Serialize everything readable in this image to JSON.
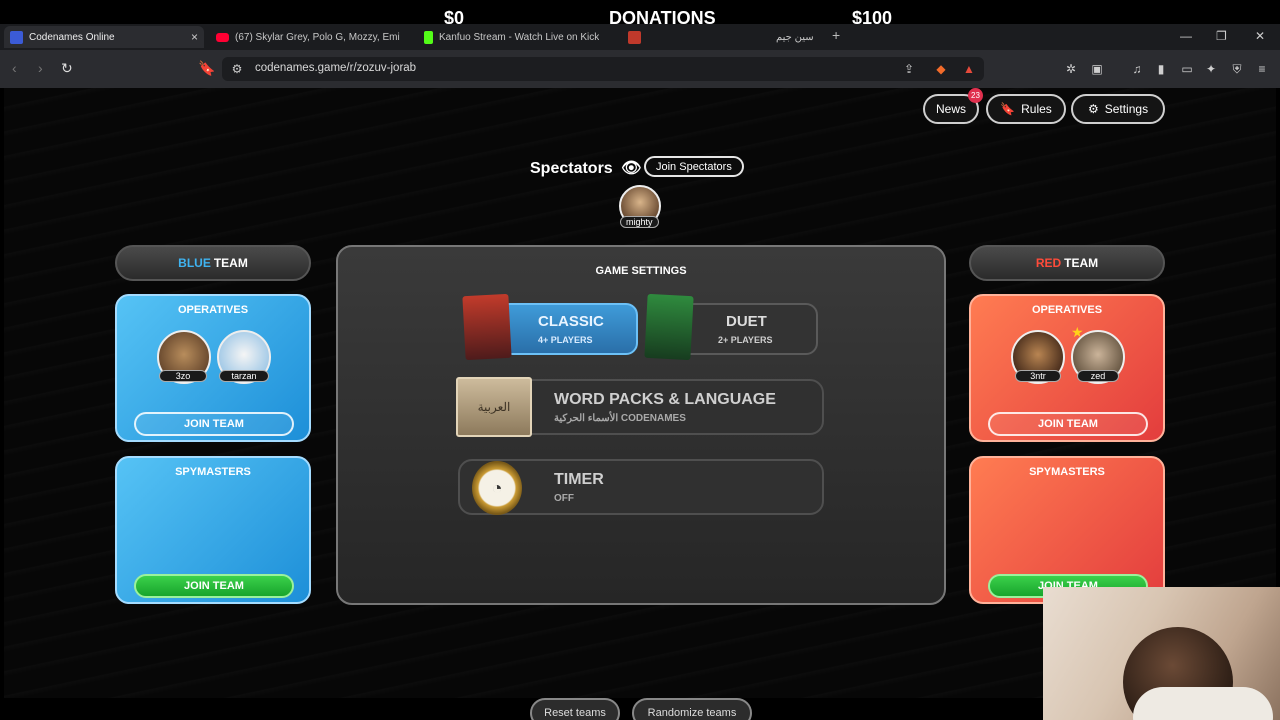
{
  "overlay": {
    "donation_current": "$0",
    "donation_title": "DONATIONS",
    "donation_goal": "$100"
  },
  "browser": {
    "tabs": [
      {
        "title": "Codenames Online",
        "close": "×",
        "active": true,
        "color": "#3b5bd6"
      },
      {
        "title": "(67) Skylar Grey, Polo G, Mozzy, Emi",
        "color": "#ff0033"
      },
      {
        "title": "Kanfuo Stream - Watch Live on Kick",
        "color": "#53fc18"
      },
      {
        "title": "",
        "color": "#c0392b"
      },
      {
        "title": "سين جيم",
        "color": "#888888"
      }
    ],
    "new_tab": "+",
    "url": "codenames.game/r/zozuv-jorab"
  },
  "header": {
    "news_label": "News",
    "news_badge": "23",
    "rules_label": "Rules",
    "settings_label": "Settings"
  },
  "spectators": {
    "title": "Spectators",
    "join_label": "Join Spectators",
    "members": [
      "mighty"
    ]
  },
  "blue_team": {
    "header_color_word": "BLUE",
    "header_team_word": "TEAM",
    "accent": "#3fb3f0",
    "operatives_title": "OPERATIVES",
    "operatives": [
      "3zo",
      "tarzan"
    ],
    "operatives_join": "JOIN TEAM",
    "spymasters_title": "SPYMASTERS",
    "spymasters_join": "JOIN TEAM"
  },
  "red_team": {
    "header_color_word": "RED",
    "header_team_word": "TEAM",
    "accent": "#ff4b3a",
    "operatives_title": "OPERATIVES",
    "operatives": [
      "3ntr",
      "zed"
    ],
    "operatives_join": "JOIN TEAM",
    "spymasters_title": "SPYMASTERS",
    "spymasters_join": "JOIN TEAM"
  },
  "game_settings": {
    "title": "GAME SETTINGS",
    "modes": [
      {
        "name": "CLASSIC",
        "sub": "4+ PLAYERS",
        "selected": true
      },
      {
        "name": "DUET",
        "sub": "2+ PLAYERS",
        "selected": false
      }
    ],
    "word_packs": {
      "name": "WORD PACKS & LANGUAGE",
      "sub": "الأسماء الحركية CODENAMES",
      "box_label": "العربية"
    },
    "timer": {
      "name": "TIMER",
      "sub": "OFF"
    },
    "reset_label": "Reset teams",
    "randomize_label": "Randomize teams"
  }
}
